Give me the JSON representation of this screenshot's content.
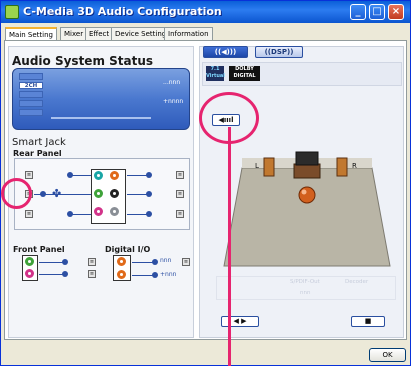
{
  "window": {
    "title": "C-Media 3D Audio Configuration",
    "controls": {
      "minimize": "_",
      "maximize": "□",
      "close": "×"
    }
  },
  "tabs": [
    {
      "label": "Main Setting",
      "active": true
    },
    {
      "label": "Mixer",
      "active": false
    },
    {
      "label": "Effect",
      "active": false
    },
    {
      "label": "Device Setting",
      "active": false
    },
    {
      "label": "Information",
      "active": false
    }
  ],
  "audio_status": {
    "title": "Audio System Status",
    "channels": [
      "",
      "2CH",
      "",
      "",
      ""
    ],
    "active_channel": "2CH",
    "line_glyphs": [
      "...nnn",
      "+nnnn"
    ]
  },
  "smart_jack": {
    "title": "Smart Jack",
    "rear_panel": "Rear Panel",
    "front_panel": "Front Panel",
    "digital_io": "Digital I/O",
    "digital_glyphs": [
      "nnn",
      "+nnn"
    ],
    "jack_colors": {
      "teal": "#1aa6a6",
      "orange": "#e06a1a",
      "green": "#3fa33a",
      "black": "#222222",
      "pink": "#d2348a",
      "gray": "#8a8f96"
    }
  },
  "right_panel": {
    "mode_buttons": [
      {
        "label": "((◀)))",
        "active": true
      },
      {
        "label": "((DSP))",
        "active": false
      }
    ],
    "logo_71": {
      "line1": "7.1",
      "line2": "Virtual"
    },
    "logo_dolby": {
      "line1": "DOLBY",
      "line2": "DIGITAL"
    },
    "volume_icon": "◀ıııl",
    "speaker_labels": {
      "left": "L",
      "right": "R"
    },
    "faded_labels": {
      "spdif_out": "S/PDIF-Out",
      "decoder": "Decoder",
      "spdif_glyph": "nnn"
    },
    "transport_play": "◀ ▶",
    "transport_stop": "■"
  },
  "footer": {
    "ok_label": "OK"
  },
  "colors": {
    "titlebar": "#0a5fd8",
    "callout": "#e6246f",
    "accent_blue": "#2c4fa3"
  }
}
